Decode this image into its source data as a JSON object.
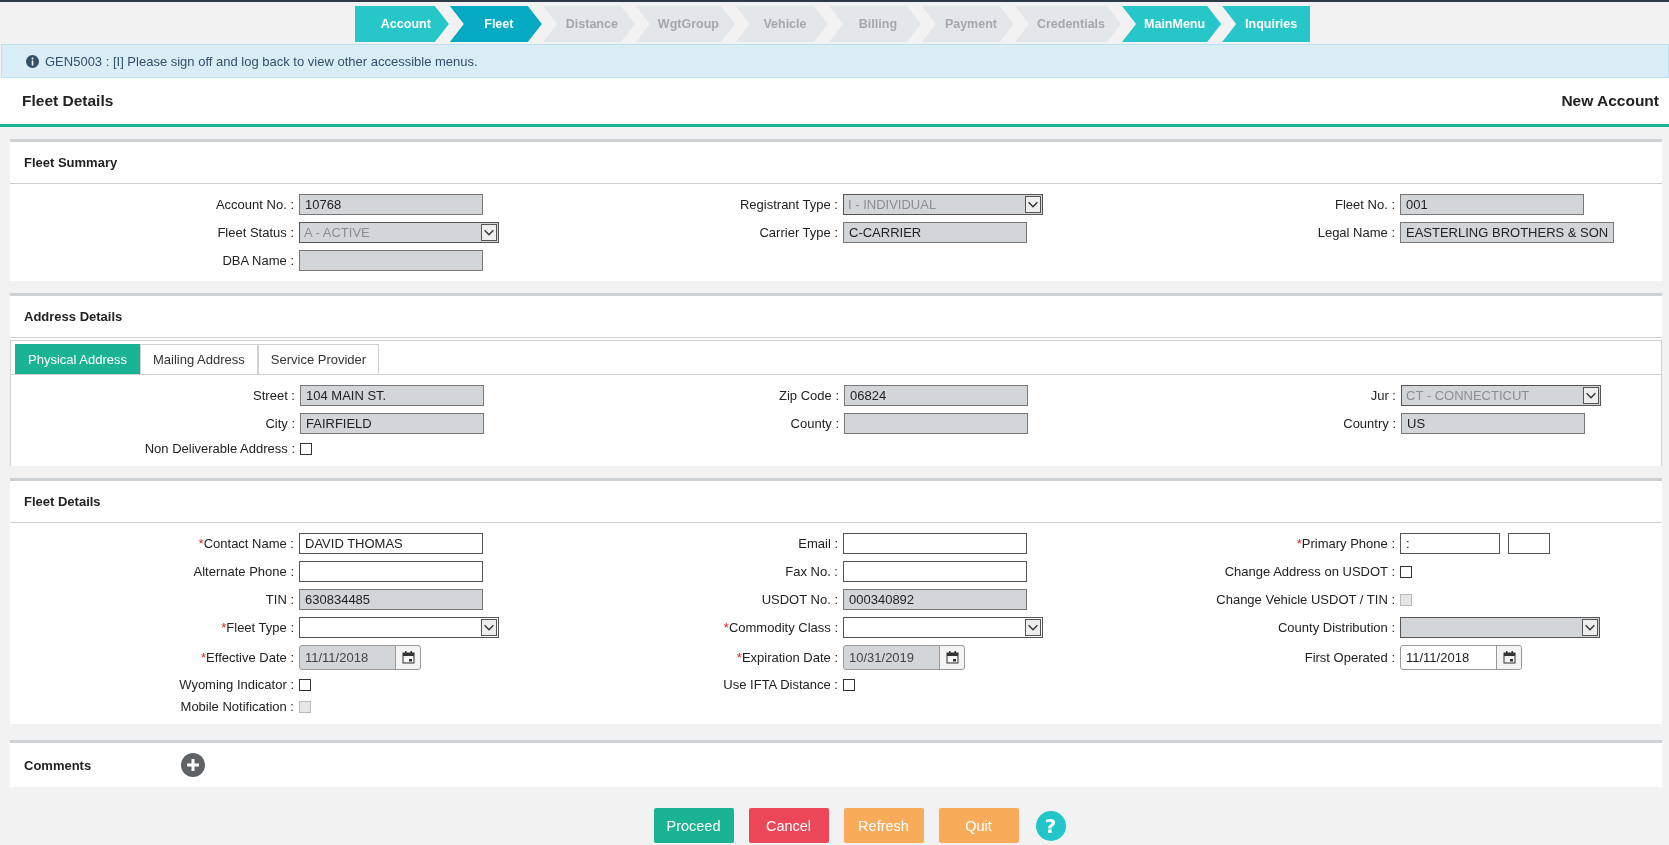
{
  "steps": [
    {
      "label": "Account",
      "selected": false,
      "enabled": true
    },
    {
      "label": "Fleet",
      "selected": true,
      "enabled": true
    },
    {
      "label": "Distance",
      "selected": false,
      "enabled": false
    },
    {
      "label": "WgtGroup",
      "selected": false,
      "enabled": false
    },
    {
      "label": "Vehicle",
      "selected": false,
      "enabled": false
    },
    {
      "label": "Billing",
      "selected": false,
      "enabled": false
    },
    {
      "label": "Payment",
      "selected": false,
      "enabled": false
    },
    {
      "label": "Credentials",
      "selected": false,
      "enabled": false
    },
    {
      "label": "MainMenu",
      "selected": false,
      "enabled": true
    },
    {
      "label": "Inquiries",
      "selected": false,
      "enabled": true
    }
  ],
  "message": "GEN5003 : [I] Please sign off and log back to view other accessible menus.",
  "header": {
    "title": "Fleet Details",
    "mode": "New Account"
  },
  "sections": [
    {
      "title": "Fleet Summary",
      "rows": [
        [
          {
            "label": "Account No. :",
            "kind": "text",
            "value": "10768",
            "disabled": true
          },
          {
            "label": "Registrant Type :",
            "kind": "select",
            "value": "I - INDIVIDUAL",
            "disabled": true
          },
          {
            "label": "Fleet No. :",
            "kind": "text",
            "value": "001",
            "disabled": true
          }
        ],
        [
          {
            "label": "Fleet Status :",
            "kind": "select",
            "value": "A - ACTIVE",
            "disabled": true
          },
          {
            "label": "Carrier Type :",
            "kind": "text",
            "value": "C-CARRIER",
            "disabled": true
          },
          {
            "label": "Legal Name :",
            "kind": "text",
            "value": "EASTERLING BROTHERS & SON",
            "disabled": true
          }
        ],
        [
          {
            "label": "DBA Name :",
            "kind": "text",
            "disabled": true
          }
        ]
      ]
    },
    {
      "title": "Address Details",
      "tabs": [
        {
          "label": "Physical Address",
          "selected": true
        },
        {
          "label": "Mailing Address",
          "selected": false
        },
        {
          "label": "Service Provider",
          "selected": false
        }
      ],
      "rows": [
        [
          {
            "label": "Street :",
            "kind": "text",
            "value": "104 MAIN ST.",
            "disabled": true
          },
          {
            "label": "Zip Code :",
            "kind": "text",
            "value": "06824",
            "disabled": true
          },
          {
            "label": "Jur :",
            "kind": "select",
            "value": "CT - CONNECTICUT",
            "disabled": true
          }
        ],
        [
          {
            "label": "City :",
            "kind": "text",
            "value": "FAIRFIELD",
            "disabled": true
          },
          {
            "label": "County :",
            "kind": "text",
            "disabled": true
          },
          {
            "label": "Country :",
            "kind": "text",
            "value": "US",
            "disabled": true
          }
        ],
        [
          {
            "label": "Non Deliverable Address :",
            "kind": "checkbox",
            "checked": false,
            "disabled": false
          }
        ]
      ]
    },
    {
      "title": "Fleet Details",
      "rows": [
        [
          {
            "label": "Contact Name :",
            "required_mark": "*",
            "kind": "text",
            "value": "DAVID THOMAS",
            "disabled": false
          },
          {
            "label": "Email :",
            "kind": "text",
            "disabled": false
          },
          {
            "label": "Primary Phone :",
            "required_mark": "*",
            "kind": "phone",
            "value": ":",
            "disabled": false
          }
        ],
        [
          {
            "label": "Alternate Phone :",
            "kind": "text",
            "disabled": false
          },
          {
            "label": "Fax No. :",
            "kind": "text",
            "disabled": false
          },
          {
            "label": "Change Address on USDOT :",
            "kind": "checkbox",
            "checked": false,
            "disabled": false
          }
        ],
        [
          {
            "label": "TIN :",
            "kind": "text",
            "value": "630834485",
            "disabled": true
          },
          {
            "label": "USDOT No. :",
            "kind": "text",
            "value": "000340892",
            "disabled": true
          },
          {
            "label": "Change Vehicle USDOT / TIN :",
            "kind": "checkbox",
            "checked": false,
            "disabled": true
          }
        ],
        [
          {
            "label": "Fleet Type :",
            "required_mark": "*",
            "kind": "select",
            "disabled": false
          },
          {
            "label": "Commodity Class :",
            "required_mark": "*",
            "kind": "select",
            "disabled": false
          },
          {
            "label": "County Distribution :",
            "kind": "select",
            "disabled": true
          }
        ],
        [
          {
            "label": "Effective Date :",
            "required_mark": "*",
            "kind": "date",
            "value": "11/11/2018",
            "disabled": true
          },
          {
            "label": "Expiration Date :",
            "required_mark": "*",
            "kind": "date",
            "value": "10/31/2019",
            "disabled": true
          },
          {
            "label": "First Operated :",
            "kind": "date",
            "value": "11/11/2018",
            "disabled": false
          }
        ],
        [
          {
            "label": "Wyoming Indicator :",
            "kind": "checkbox",
            "checked": false,
            "disabled": false
          },
          {
            "label": "Use IFTA Distance :",
            "kind": "checkbox",
            "checked": false,
            "disabled": false
          }
        ],
        [
          {
            "label": "Mobile Notification :",
            "kind": "checkbox",
            "checked": false,
            "disabled": true
          }
        ]
      ]
    }
  ],
  "comments": {
    "title": "Comments"
  },
  "buttons": [
    {
      "label": "Proceed",
      "kind": "proceed"
    },
    {
      "label": "Cancel",
      "kind": "cancel"
    },
    {
      "label": "Refresh",
      "kind": "refresh"
    },
    {
      "label": "Quit",
      "kind": "quit"
    }
  ],
  "help": "?"
}
